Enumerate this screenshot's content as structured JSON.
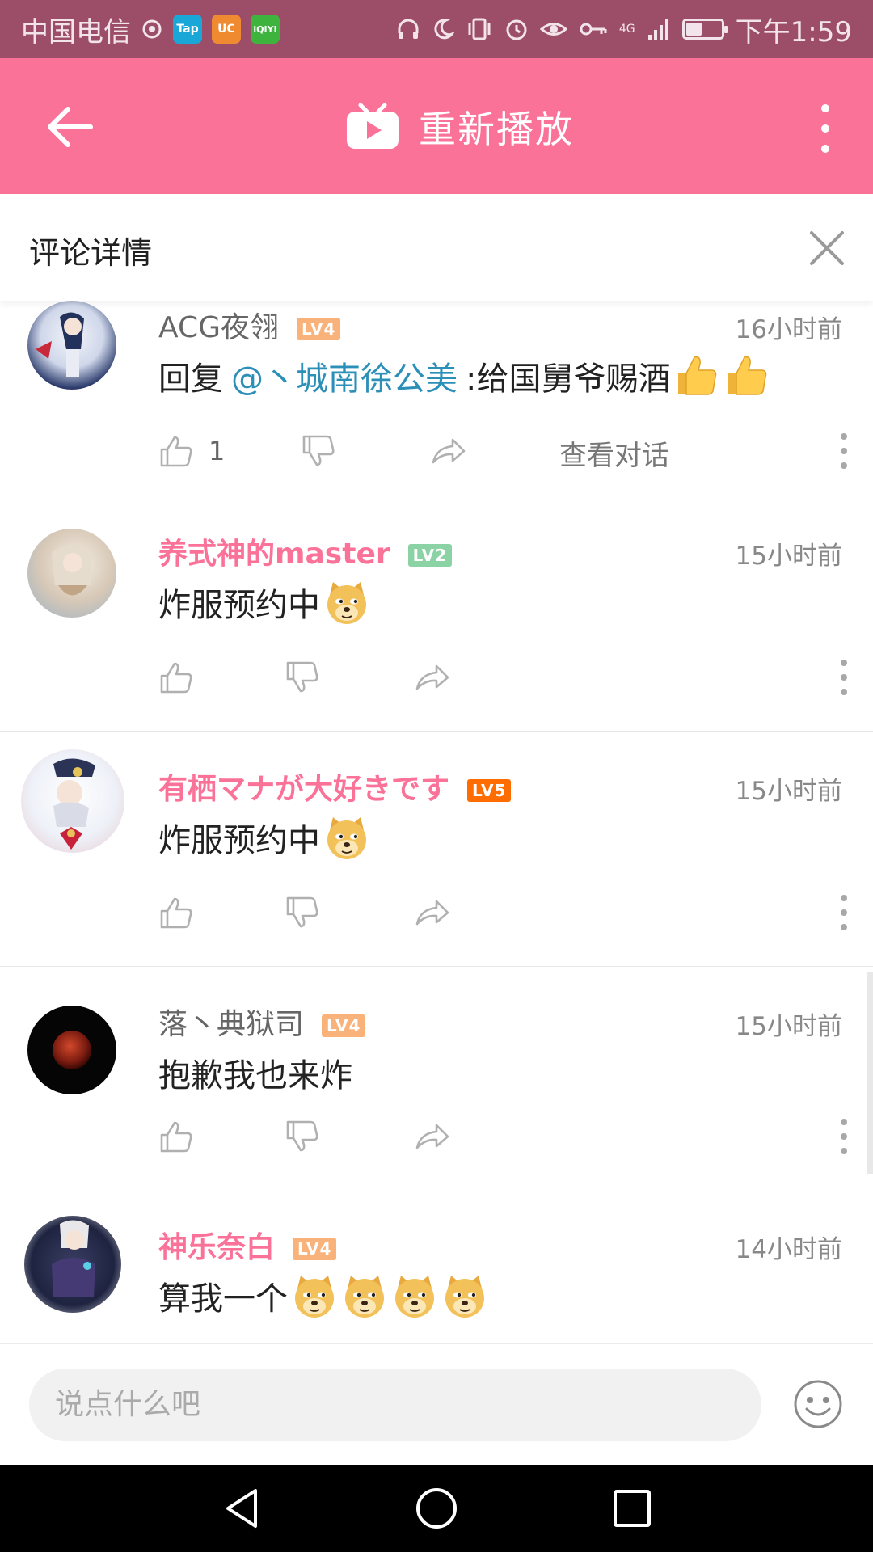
{
  "status_bar": {
    "carrier": "中国电信",
    "app_icons": [
      "Tap",
      "UC",
      "iQIYI"
    ],
    "network": "4G",
    "battery_level": 0.45,
    "time": "下午1:59"
  },
  "header": {
    "title": "重新播放",
    "accent_color": "#fb7299"
  },
  "panel": {
    "title": "评论详情"
  },
  "comments": [
    {
      "user": "ACG夜翎",
      "level": "LV4",
      "level_color": "#f9b27a",
      "vip": false,
      "time": "16小时前",
      "reply_prefix": "回复",
      "mention": "@丶城南徐公美",
      "text": ":给国舅爷赐酒",
      "emojis": [
        "thumbs-up",
        "thumbs-up"
      ],
      "likes": "1",
      "view_conversation": "查看对话"
    },
    {
      "user": "养式神的master",
      "level": "LV2",
      "level_color": "#8bd2a5",
      "vip": true,
      "time": "15小时前",
      "text": "炸服预约中",
      "emojis": [
        "doge"
      ]
    },
    {
      "user": "有栖マナが大好きです",
      "level": "LV5",
      "level_color": "#ff6c00",
      "vip": true,
      "time": "15小时前",
      "text": "炸服预约中",
      "emojis": [
        "doge"
      ]
    },
    {
      "user": "落丶典狱司",
      "level": "LV4",
      "level_color": "#f9b27a",
      "vip": false,
      "time": "15小时前",
      "text": "抱歉我也来炸",
      "emojis": []
    },
    {
      "user": "神乐奈白",
      "level": "LV4",
      "level_color": "#f9b27a",
      "vip": true,
      "time": "14小时前",
      "text": "算我一个",
      "emojis": [
        "doge",
        "doge",
        "doge",
        "doge"
      ]
    }
  ],
  "input": {
    "placeholder": "说点什么吧"
  }
}
